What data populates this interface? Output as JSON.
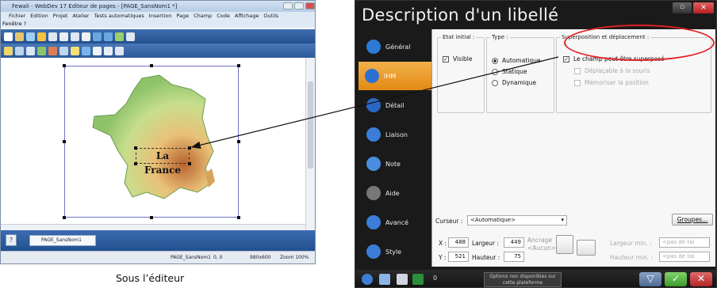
{
  "editor": {
    "title": "Fewali - WebDev 17 Editeur de pages - [PAGE_SansNom1 *]",
    "menu": [
      "Fichier",
      "Edition",
      "Projet",
      "Atelier",
      "Tests automatiques",
      "Insertion",
      "Page",
      "Champ",
      "Code",
      "Affichage",
      "Outils"
    ],
    "menu2": "Fenêtre  ?",
    "label_text": "La France",
    "page_tab": "PAGE_SansNom1",
    "status": {
      "page": "PAGE_SansNom1",
      "coords": "0, 0",
      "size": "980x600",
      "zoom": "Zoom 100%"
    }
  },
  "caption": "Sous l’éditeur",
  "dialog": {
    "title": "Description d'un libellé",
    "tabs": [
      {
        "label": "Général",
        "icon": "general-icon"
      },
      {
        "label": "IHM",
        "icon": "eye-icon",
        "active": true
      },
      {
        "label": "Détail",
        "icon": "detail-icon"
      },
      {
        "label": "Liaison",
        "icon": "link-icon"
      },
      {
        "label": "Note",
        "icon": "note-icon"
      },
      {
        "label": "Aide",
        "icon": "help-icon"
      },
      {
        "label": "Avancé",
        "icon": "advanced-icon"
      },
      {
        "label": "Style",
        "icon": "style-icon"
      }
    ],
    "etat_initial": {
      "title": "Etat initial :",
      "visible_label": "Visible",
      "visible_checked": true
    },
    "type": {
      "title": "Type :",
      "options": [
        "Automatique",
        "Statique",
        "Dynamique"
      ],
      "selected": "Automatique"
    },
    "superposition": {
      "title": "Superposition et déplacement :",
      "options": [
        "Le champ peut être superposé",
        "Déplaçable à la souris",
        "Mémoriser la position"
      ],
      "checked": [
        true,
        false,
        false
      ]
    },
    "curseur": {
      "label": "Curseur :",
      "value": "<Automatique>"
    },
    "groupes_button": "Groupes...",
    "x": {
      "label": "X :",
      "value": "488"
    },
    "y": {
      "label": "Y :",
      "value": "521"
    },
    "largeur": {
      "label": "Largeur :",
      "value": "449"
    },
    "hauteur": {
      "label": "Hauteur :",
      "value": "75"
    },
    "ancrage": {
      "label": "Ancrage",
      "value": "<Aucun>"
    },
    "largeur_min": {
      "label": "Largeur min. :",
      "value": "<pas de tai"
    },
    "hauteur_min": {
      "label": "Hauteur min. :",
      "value": "<pas de tai"
    },
    "not_available": "Options non disponibles sur cette plateforme",
    "bottom_value": "0"
  },
  "colors": {
    "accent_orange": "#e8941e",
    "highlight_red": "#e02222",
    "ok_green": "#4caf3a",
    "cancel_red": "#c83030"
  }
}
